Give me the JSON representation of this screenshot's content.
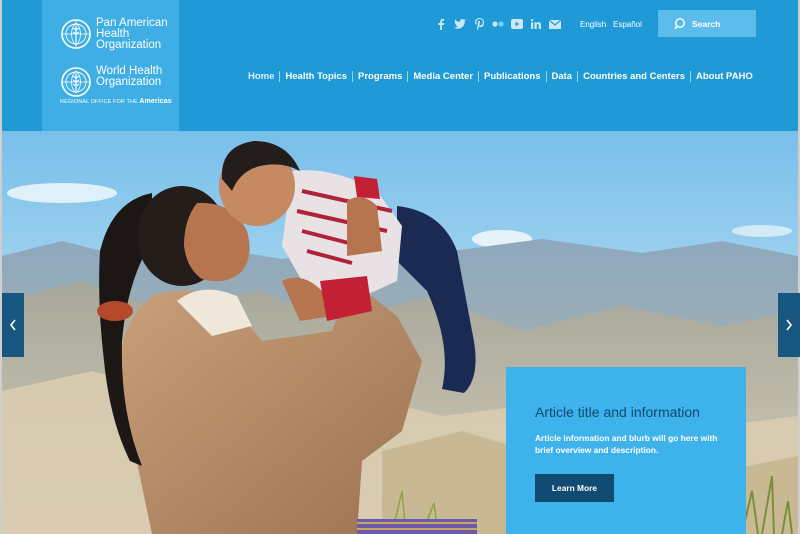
{
  "org": {
    "paho_name": "Pan American Health Organization",
    "paho_line1": "Pan American",
    "paho_line2": "Health",
    "paho_line3": "Organization",
    "who_line1": "World Health",
    "who_line2": "Organization",
    "who_sub_small": "REGIONAL OFFICE FOR THE",
    "who_sub_big": "Americas"
  },
  "social_icons": [
    "facebook-icon",
    "twitter-icon",
    "pinterest-icon",
    "flickr-icon",
    "youtube-icon",
    "linkedin-icon",
    "email-icon"
  ],
  "languages": {
    "english": "English",
    "spanish": "Español"
  },
  "search": {
    "label": "Search"
  },
  "nav": {
    "items": [
      {
        "label": "Home",
        "active": true
      },
      {
        "label": "Health Topics"
      },
      {
        "label": "Programs"
      },
      {
        "label": "Media Center"
      },
      {
        "label": "Publications"
      },
      {
        "label": "Data"
      },
      {
        "label": "Countries and Centers"
      },
      {
        "label": "About PAHO"
      }
    ]
  },
  "hero": {
    "card": {
      "title": "Article title and information",
      "description": "Article information and blurb will go here with brief overview and description.",
      "button": "Learn More"
    },
    "prev_label": "‹",
    "next_label": "›"
  },
  "colors": {
    "header_bg": "#1f9ad6",
    "logo_panel": "#3eaee4",
    "card_bg": "#3eb2ea",
    "button_bg": "#114a72",
    "arrow_bg": "#17567e"
  }
}
